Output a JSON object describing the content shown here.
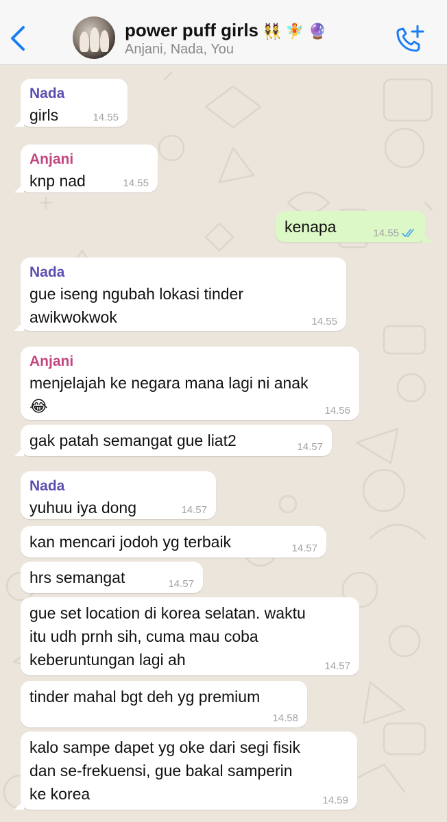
{
  "header": {
    "back_icon": "chevron-left-icon",
    "title": "power puff girls",
    "title_emojis": "👯🧚🔮",
    "subtitle": "Anjani, Nada, You",
    "call_icon": "add-call-icon",
    "accent_color": "#1a7cf5"
  },
  "colors": {
    "background": "#ece5dc",
    "incoming_bubble": "#ffffff",
    "outgoing_bubble": "#dcf8c6",
    "nada_name": "#5a4fb0",
    "anjani_name": "#c2457f",
    "read_ticks": "#4fa8e8"
  },
  "messages": [
    {
      "sender": "Nada",
      "text": "girls",
      "time": "14.55"
    },
    {
      "sender": "Anjani",
      "text": "knp nad",
      "time": "14.55"
    },
    {
      "sender": "You",
      "text": "kenapa",
      "time": "14.55",
      "read": true
    },
    {
      "sender": "Nada",
      "text_lines": [
        "gue iseng ngubah lokasi tinder",
        "awikwokwok"
      ],
      "time": "14.55"
    },
    {
      "sender": "Anjani",
      "text_lines": [
        "menjelajah ke negara mana lagi ni anak",
        "😂"
      ],
      "time": "14.56"
    },
    {
      "text": "gak patah semangat gue liat2",
      "time": "14.57"
    },
    {
      "sender": "Nada",
      "text": "yuhuu iya dong",
      "time": "14.57"
    },
    {
      "text": "kan mencari jodoh yg terbaik",
      "time": "14.57"
    },
    {
      "text": "hrs semangat",
      "time": "14.57"
    },
    {
      "text_lines": [
        "gue set location di korea selatan. waktu",
        "itu udh prnh sih, cuma mau coba",
        "keberuntungan lagi ah"
      ],
      "time": "14.57"
    },
    {
      "text": "tinder mahal bgt deh yg premium",
      "time": "14.58"
    },
    {
      "text_lines": [
        "kalo sampe dapet yg oke dari segi fisik",
        "dan se-frekuensi, gue bakal samperin",
        "ke korea"
      ],
      "time": "14.59"
    }
  ]
}
